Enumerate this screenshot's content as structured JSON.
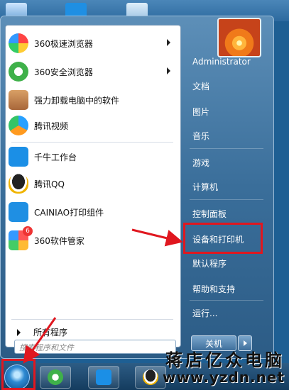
{
  "left_menu": {
    "items": [
      {
        "label": "360极速浏览器",
        "icon": "360-speed-browser-icon",
        "has_arrow": true
      },
      {
        "label": "360安全浏览器",
        "icon": "360-safe-browser-icon",
        "has_arrow": true
      },
      {
        "label": "强力卸载电脑中的软件",
        "icon": "uninstall-icon",
        "has_arrow": false
      },
      {
        "label": "腾讯视频",
        "icon": "tencent-video-icon",
        "has_arrow": false
      },
      {
        "label": "千牛工作台",
        "icon": "qianniu-icon",
        "has_arrow": false
      },
      {
        "label": "腾讯QQ",
        "icon": "qq-penguin-icon",
        "has_arrow": false
      },
      {
        "label": "CAINIAO打印组件",
        "icon": "cainiao-print-icon",
        "has_arrow": false
      },
      {
        "label": "360软件管家",
        "icon": "360-software-manager-icon",
        "has_arrow": false,
        "badge": "6"
      }
    ],
    "all_programs": "所有程序",
    "search_placeholder": "搜索程序和文件"
  },
  "right_menu": {
    "items": [
      "Administrator",
      "文档",
      "图片",
      "音乐",
      "游戏",
      "计算机",
      "控制面板",
      "设备和打印机",
      "默认程序",
      "帮助和支持",
      "运行..."
    ],
    "shutdown": "关机"
  },
  "watermark": {
    "title": "蒋店亿众电脑",
    "url": "www.yzdn.net"
  },
  "colors": {
    "highlight": "#e0171f",
    "menu_blue": "#3a6e9a"
  }
}
